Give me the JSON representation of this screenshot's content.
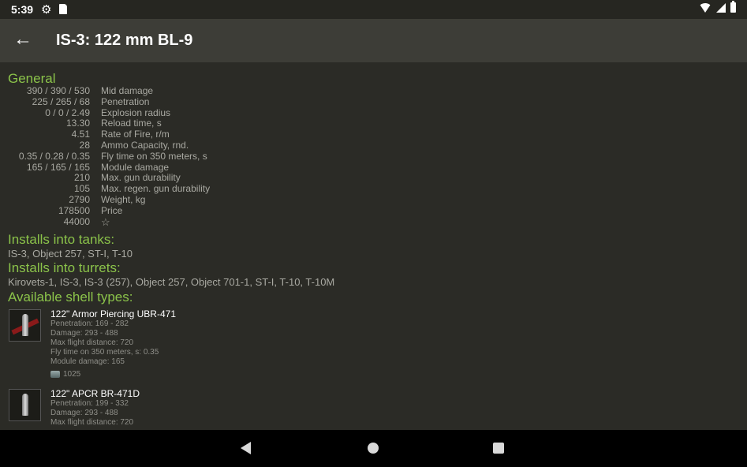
{
  "status_bar": {
    "time": "5:39"
  },
  "toolbar": {
    "title": "IS-3: 122 mm BL-9"
  },
  "general": {
    "title": "General",
    "stats": [
      {
        "value": "390 / 390 / 530",
        "label": "Mid damage"
      },
      {
        "value": "225 / 265 / 68",
        "label": "Penetration"
      },
      {
        "value": "0 / 0 / 2.49",
        "label": "Explosion radius"
      },
      {
        "value": "13.30",
        "label": "Reload time, s"
      },
      {
        "value": "4.51",
        "label": "Rate of Fire, r/m"
      },
      {
        "value": "28",
        "label": "Ammo Capacity, rnd."
      },
      {
        "value": "0.35 / 0.28 / 0.35",
        "label": "Fly time on 350 meters, s"
      },
      {
        "value": "165 / 165 / 165",
        "label": "Module damage"
      },
      {
        "value": "210",
        "label": "Max. gun durability"
      },
      {
        "value": "105",
        "label": "Max. regen. gun durability"
      },
      {
        "value": "2790",
        "label": "Weight, kg"
      },
      {
        "value": "178500",
        "label": "Price"
      },
      {
        "value": "44000",
        "label": "☆"
      }
    ]
  },
  "installs_tanks": {
    "title": "Installs into tanks:",
    "list": "IS-3, Object 257, ST-I, T-10"
  },
  "installs_turrets": {
    "title": "Installs into turrets:",
    "list": "Kirovets-1, IS-3, IS-3 (257), Object 257, Object 701-1, ST-I, T-10, T-10M"
  },
  "shells": {
    "title": "Available shell types:",
    "items": [
      {
        "name": "122\" Armor Piercing UBR-471",
        "penetration": "Penetration: 169 - 282",
        "damage": "Damage: 293 - 488",
        "max_flight": "Max flight distance: 720",
        "fly_time": "Fly time on 350 meters, s: 0.35",
        "module_damage": "Module damage: 165",
        "price": "1025"
      },
      {
        "name": "122\" APCR BR-471D",
        "penetration": "Penetration: 199 - 332",
        "damage": "Damage: 293 - 488",
        "max_flight": "Max flight distance: 720"
      }
    ]
  }
}
